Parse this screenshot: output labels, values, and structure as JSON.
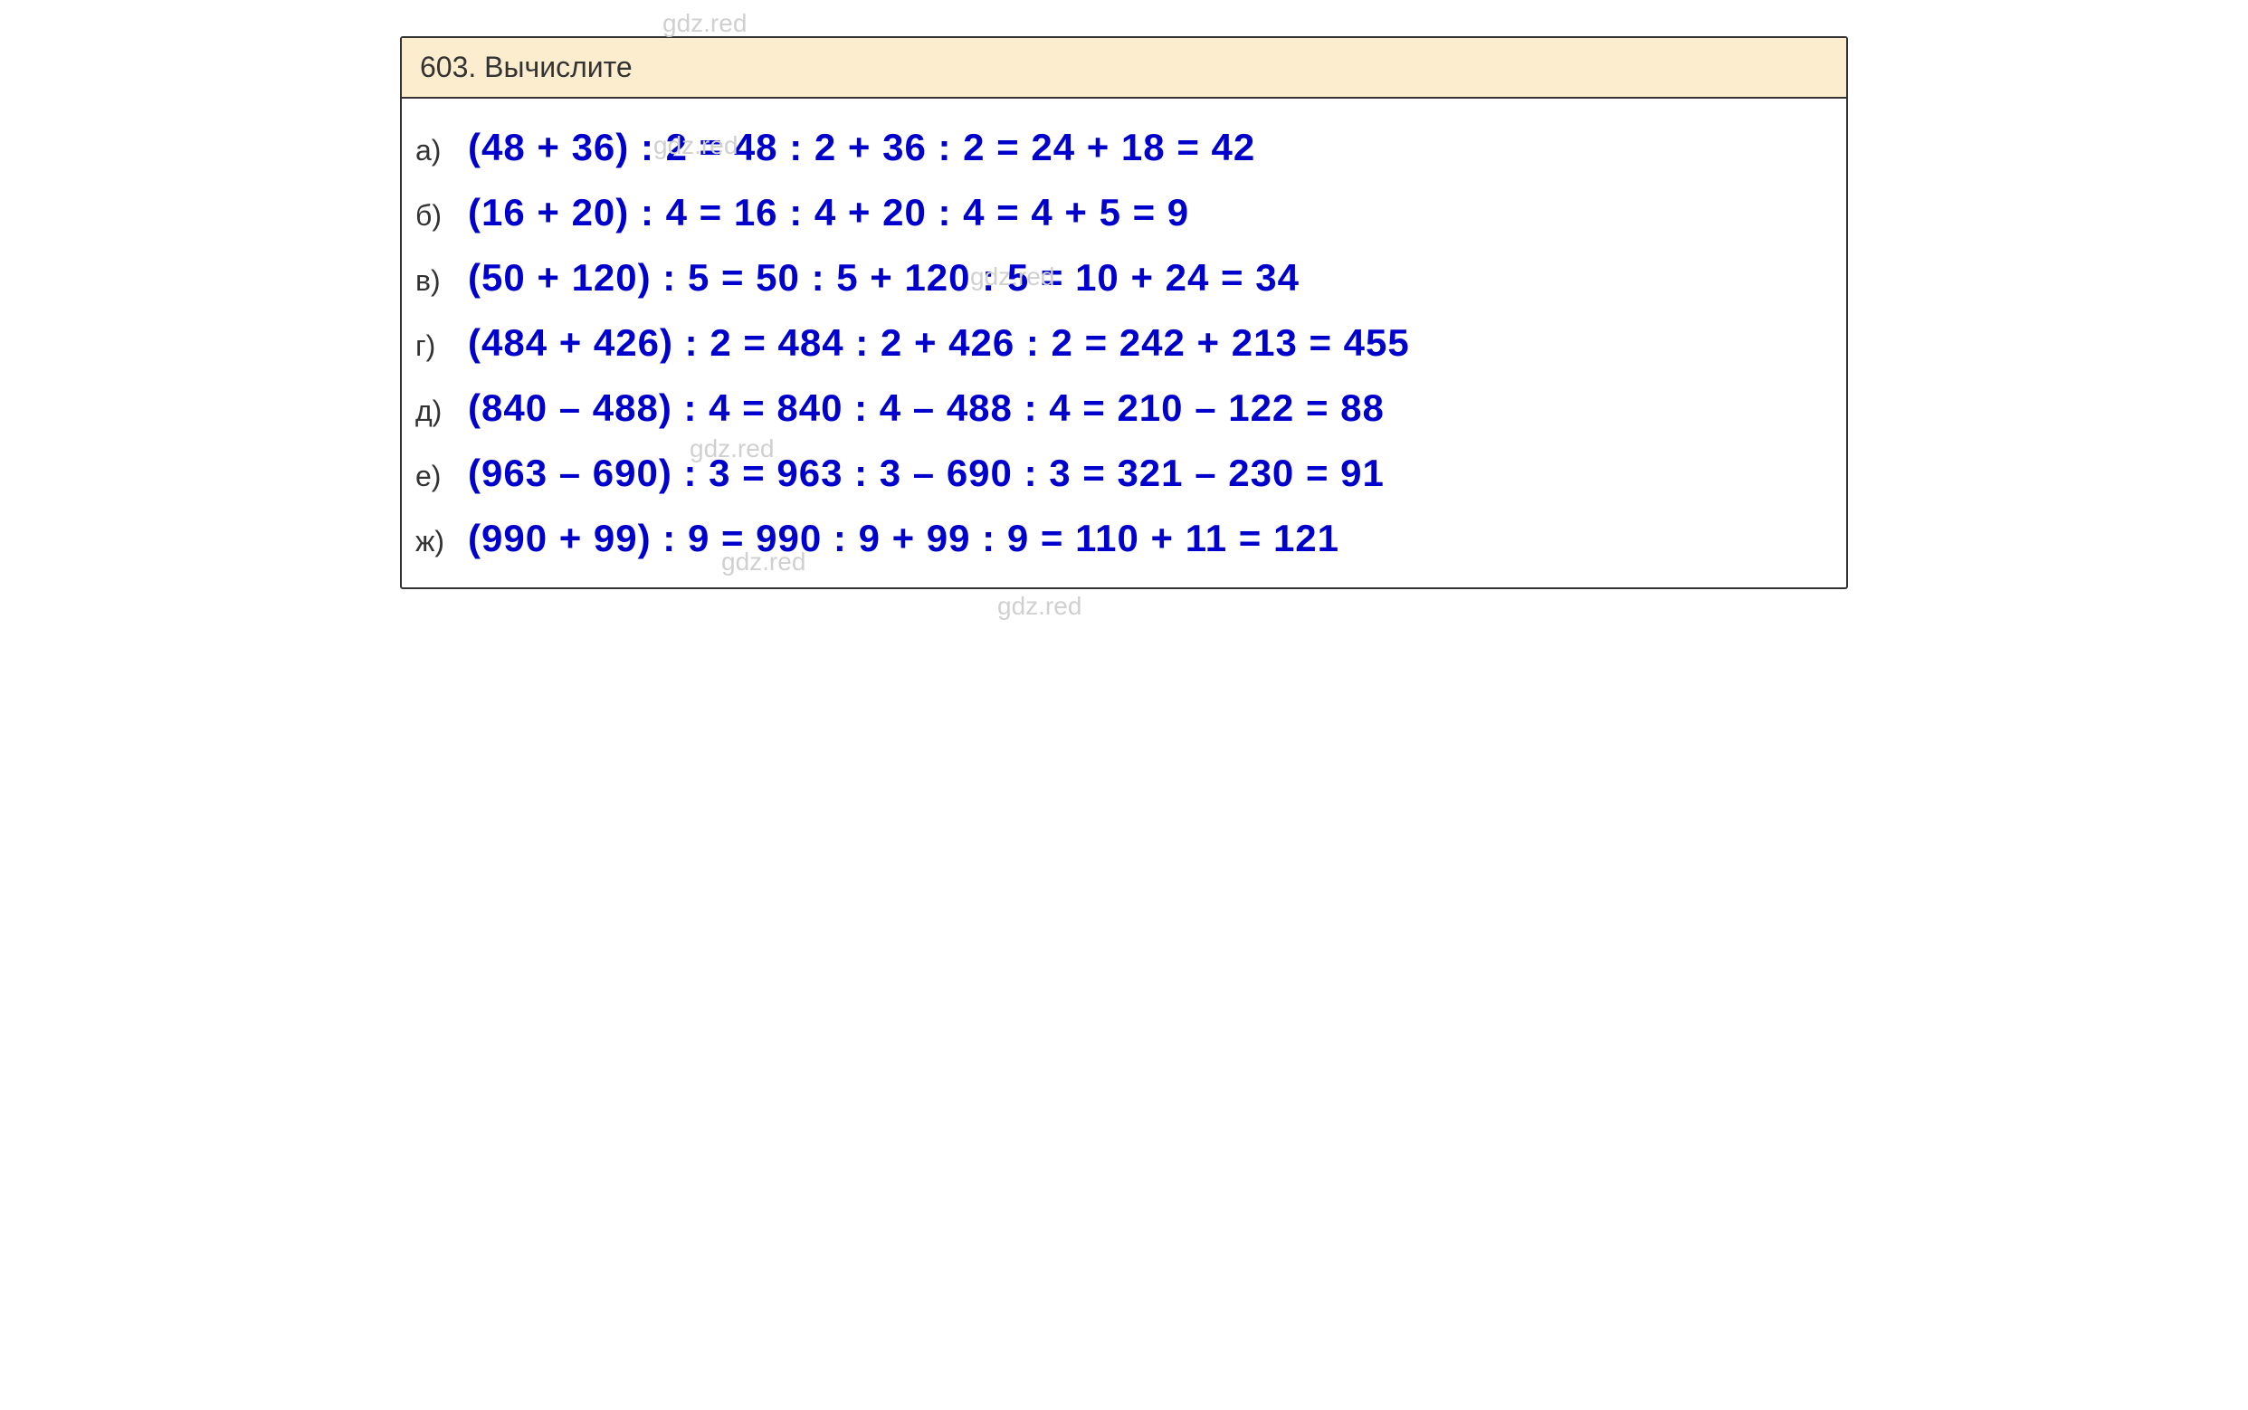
{
  "watermarks": {
    "text": "gdz.red"
  },
  "header": {
    "number": "603.",
    "title": "Вычислите"
  },
  "rows": [
    {
      "label": "а)",
      "equation": "(48 + 36) : 2 = 48 : 2 + 36 : 2 = 24 + 18 = 42"
    },
    {
      "label": "б)",
      "equation": "(16 + 20) : 4 = 16 : 4 + 20 : 4 = 4 + 5 = 9"
    },
    {
      "label": "в)",
      "equation": "(50 + 120) : 5 = 50 : 5 + 120 : 5 = 10 + 24 = 34"
    },
    {
      "label": "г)",
      "equation": "(484 + 426) : 2 = 484 : 2 + 426 : 2 = 242 + 213 = 455"
    },
    {
      "label": "д)",
      "equation": "(840 – 488) : 4 = 840 : 4 – 488 : 4 = 210 – 122 = 88"
    },
    {
      "label": "е)",
      "equation": "(963 – 690) : 3 = 963 : 3 – 690 : 3 = 321 – 230 = 91"
    },
    {
      "label": "ж)",
      "equation": "(990 + 99) : 9 = 990 : 9 + 99 : 9 = 110 + 11 = 121"
    }
  ]
}
